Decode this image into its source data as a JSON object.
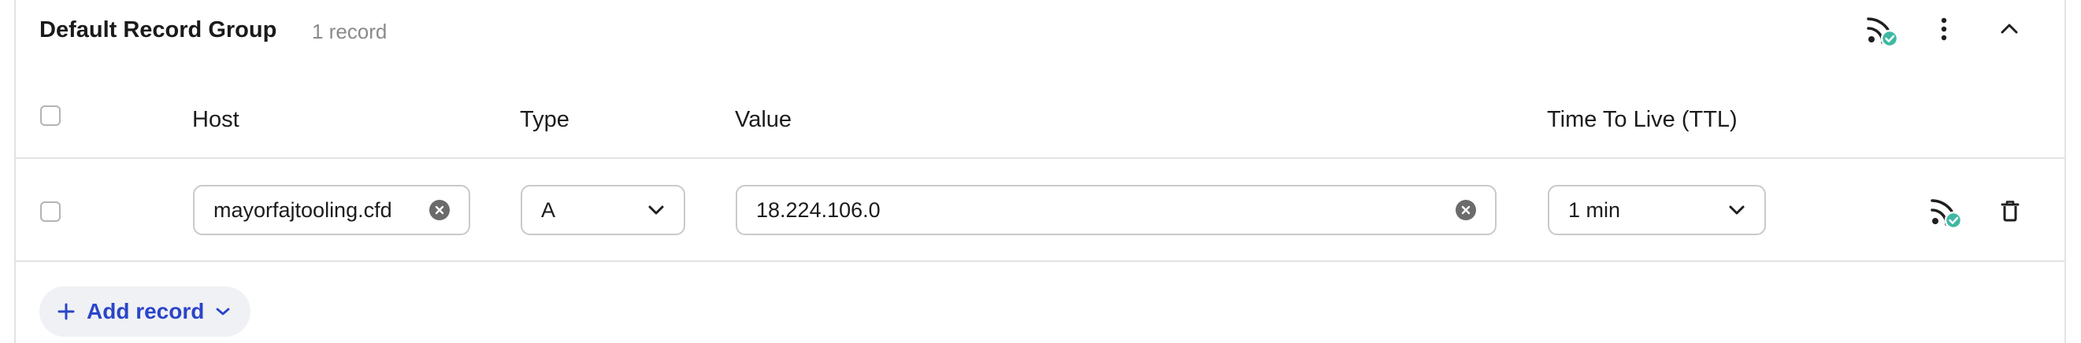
{
  "group": {
    "title": "Default Record Group",
    "count_label": "1 record",
    "icons": [
      "feed-verified-icon",
      "more-vertical-icon",
      "chevron-up-icon"
    ]
  },
  "table": {
    "headers": {
      "host": "Host",
      "type": "Type",
      "value": "Value",
      "ttl": "Time To Live (TTL)"
    },
    "rows": [
      {
        "selected": false,
        "host": "mayorfajtooling.cfd",
        "type": "A",
        "value": "18.224.106.0",
        "ttl": "1 min",
        "icons": [
          "feed-verified-icon",
          "trash-icon"
        ]
      }
    ]
  },
  "actions": {
    "add_record_label": "Add record"
  },
  "colors": {
    "accent": "#2a45c9",
    "verified": "#3fb8a3",
    "border": "#c9c9c9",
    "divider": "#e3e3e3"
  }
}
